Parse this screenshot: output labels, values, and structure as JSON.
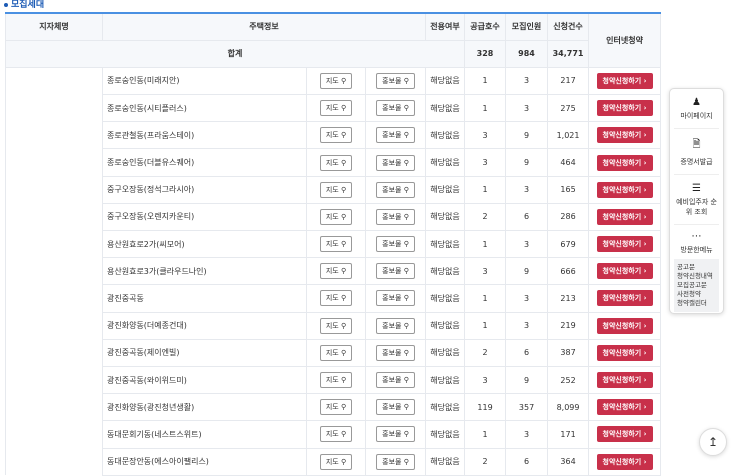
{
  "section_title": "모집세대",
  "headers": {
    "region": "지자체명",
    "house_info": "주택정보",
    "exclusive": "전용여부",
    "supply": "공급호수",
    "recruit": "모집인원",
    "applications": "신청건수",
    "internet": "인터넷청약"
  },
  "total": {
    "label": "합계",
    "supply": "328",
    "recruit": "984",
    "applications": "34,771"
  },
  "buttons": {
    "map": "지도",
    "promo": "홍보물",
    "apply": "청약신청하기"
  },
  "rows": [
    {
      "name": "종로숭인동(미래지안)",
      "exclusive": "해당없음",
      "supply": "1",
      "recruit": "3",
      "applications": "217"
    },
    {
      "name": "종로숭인동(시티플러스)",
      "exclusive": "해당없음",
      "supply": "1",
      "recruit": "3",
      "applications": "275"
    },
    {
      "name": "종로관철동(프라움스테이)",
      "exclusive": "해당없음",
      "supply": "3",
      "recruit": "9",
      "applications": "1,021"
    },
    {
      "name": "종로숭인동(더블유스퀘어)",
      "exclusive": "해당없음",
      "supply": "3",
      "recruit": "9",
      "applications": "464"
    },
    {
      "name": "중구오장동(정석그라시아)",
      "exclusive": "해당없음",
      "supply": "1",
      "recruit": "3",
      "applications": "165"
    },
    {
      "name": "중구오장동(오렌지카운티)",
      "exclusive": "해당없음",
      "supply": "2",
      "recruit": "6",
      "applications": "286"
    },
    {
      "name": "용산원효로2가(씨모어)",
      "exclusive": "해당없음",
      "supply": "1",
      "recruit": "3",
      "applications": "679"
    },
    {
      "name": "용산원효로3가(클라우드나인)",
      "exclusive": "해당없음",
      "supply": "3",
      "recruit": "9",
      "applications": "666"
    },
    {
      "name": "광진중곡동",
      "exclusive": "해당없음",
      "supply": "1",
      "recruit": "3",
      "applications": "213"
    },
    {
      "name": "광진화양동(더예종건대)",
      "exclusive": "해당없음",
      "supply": "1",
      "recruit": "3",
      "applications": "219"
    },
    {
      "name": "광진중곡동(제이엔빌)",
      "exclusive": "해당없음",
      "supply": "2",
      "recruit": "6",
      "applications": "387"
    },
    {
      "name": "광진중곡동(와이위드미)",
      "exclusive": "해당없음",
      "supply": "3",
      "recruit": "9",
      "applications": "252"
    },
    {
      "name": "광진화양동(광진청년생활)",
      "exclusive": "해당없음",
      "supply": "119",
      "recruit": "357",
      "applications": "8,099"
    },
    {
      "name": "동대문회기동(네스트스위트)",
      "exclusive": "해당없음",
      "supply": "1",
      "recruit": "3",
      "applications": "171"
    },
    {
      "name": "동대문장안동(에스아이팰리스)",
      "exclusive": "해당없음",
      "supply": "2",
      "recruit": "6",
      "applications": "364"
    }
  ],
  "side_menu": {
    "items": [
      "마이페이지",
      "증명서발급",
      "예비입주자 순위 조회",
      "방문한메뉴"
    ],
    "recent": [
      "공고문",
      "청약신청내역",
      "모집공고문",
      "사전청약",
      "청약캘린더"
    ]
  }
}
